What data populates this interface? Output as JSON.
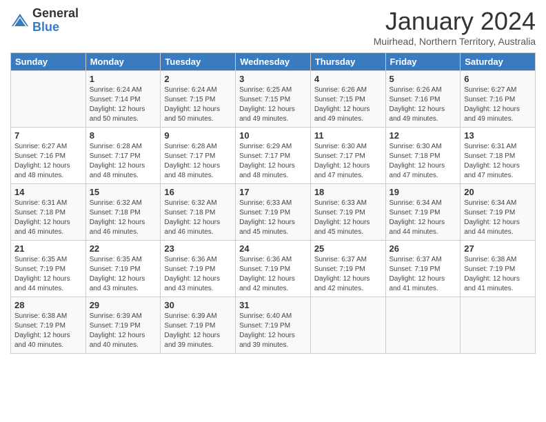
{
  "header": {
    "logo_general": "General",
    "logo_blue": "Blue",
    "month_title": "January 2024",
    "subtitle": "Muirhead, Northern Territory, Australia"
  },
  "days_of_week": [
    "Sunday",
    "Monday",
    "Tuesday",
    "Wednesday",
    "Thursday",
    "Friday",
    "Saturday"
  ],
  "weeks": [
    [
      {
        "day": "",
        "sunrise": "",
        "sunset": "",
        "daylight": ""
      },
      {
        "day": "1",
        "sunrise": "Sunrise: 6:24 AM",
        "sunset": "Sunset: 7:14 PM",
        "daylight": "Daylight: 12 hours and 50 minutes."
      },
      {
        "day": "2",
        "sunrise": "Sunrise: 6:24 AM",
        "sunset": "Sunset: 7:15 PM",
        "daylight": "Daylight: 12 hours and 50 minutes."
      },
      {
        "day": "3",
        "sunrise": "Sunrise: 6:25 AM",
        "sunset": "Sunset: 7:15 PM",
        "daylight": "Daylight: 12 hours and 49 minutes."
      },
      {
        "day": "4",
        "sunrise": "Sunrise: 6:26 AM",
        "sunset": "Sunset: 7:15 PM",
        "daylight": "Daylight: 12 hours and 49 minutes."
      },
      {
        "day": "5",
        "sunrise": "Sunrise: 6:26 AM",
        "sunset": "Sunset: 7:16 PM",
        "daylight": "Daylight: 12 hours and 49 minutes."
      },
      {
        "day": "6",
        "sunrise": "Sunrise: 6:27 AM",
        "sunset": "Sunset: 7:16 PM",
        "daylight": "Daylight: 12 hours and 49 minutes."
      }
    ],
    [
      {
        "day": "7",
        "sunrise": "Sunrise: 6:27 AM",
        "sunset": "Sunset: 7:16 PM",
        "daylight": "Daylight: 12 hours and 48 minutes."
      },
      {
        "day": "8",
        "sunrise": "Sunrise: 6:28 AM",
        "sunset": "Sunset: 7:17 PM",
        "daylight": "Daylight: 12 hours and 48 minutes."
      },
      {
        "day": "9",
        "sunrise": "Sunrise: 6:28 AM",
        "sunset": "Sunset: 7:17 PM",
        "daylight": "Daylight: 12 hours and 48 minutes."
      },
      {
        "day": "10",
        "sunrise": "Sunrise: 6:29 AM",
        "sunset": "Sunset: 7:17 PM",
        "daylight": "Daylight: 12 hours and 48 minutes."
      },
      {
        "day": "11",
        "sunrise": "Sunrise: 6:30 AM",
        "sunset": "Sunset: 7:17 PM",
        "daylight": "Daylight: 12 hours and 47 minutes."
      },
      {
        "day": "12",
        "sunrise": "Sunrise: 6:30 AM",
        "sunset": "Sunset: 7:18 PM",
        "daylight": "Daylight: 12 hours and 47 minutes."
      },
      {
        "day": "13",
        "sunrise": "Sunrise: 6:31 AM",
        "sunset": "Sunset: 7:18 PM",
        "daylight": "Daylight: 12 hours and 47 minutes."
      }
    ],
    [
      {
        "day": "14",
        "sunrise": "Sunrise: 6:31 AM",
        "sunset": "Sunset: 7:18 PM",
        "daylight": "Daylight: 12 hours and 46 minutes."
      },
      {
        "day": "15",
        "sunrise": "Sunrise: 6:32 AM",
        "sunset": "Sunset: 7:18 PM",
        "daylight": "Daylight: 12 hours and 46 minutes."
      },
      {
        "day": "16",
        "sunrise": "Sunrise: 6:32 AM",
        "sunset": "Sunset: 7:18 PM",
        "daylight": "Daylight: 12 hours and 46 minutes."
      },
      {
        "day": "17",
        "sunrise": "Sunrise: 6:33 AM",
        "sunset": "Sunset: 7:19 PM",
        "daylight": "Daylight: 12 hours and 45 minutes."
      },
      {
        "day": "18",
        "sunrise": "Sunrise: 6:33 AM",
        "sunset": "Sunset: 7:19 PM",
        "daylight": "Daylight: 12 hours and 45 minutes."
      },
      {
        "day": "19",
        "sunrise": "Sunrise: 6:34 AM",
        "sunset": "Sunset: 7:19 PM",
        "daylight": "Daylight: 12 hours and 44 minutes."
      },
      {
        "day": "20",
        "sunrise": "Sunrise: 6:34 AM",
        "sunset": "Sunset: 7:19 PM",
        "daylight": "Daylight: 12 hours and 44 minutes."
      }
    ],
    [
      {
        "day": "21",
        "sunrise": "Sunrise: 6:35 AM",
        "sunset": "Sunset: 7:19 PM",
        "daylight": "Daylight: 12 hours and 44 minutes."
      },
      {
        "day": "22",
        "sunrise": "Sunrise: 6:35 AM",
        "sunset": "Sunset: 7:19 PM",
        "daylight": "Daylight: 12 hours and 43 minutes."
      },
      {
        "day": "23",
        "sunrise": "Sunrise: 6:36 AM",
        "sunset": "Sunset: 7:19 PM",
        "daylight": "Daylight: 12 hours and 43 minutes."
      },
      {
        "day": "24",
        "sunrise": "Sunrise: 6:36 AM",
        "sunset": "Sunset: 7:19 PM",
        "daylight": "Daylight: 12 hours and 42 minutes."
      },
      {
        "day": "25",
        "sunrise": "Sunrise: 6:37 AM",
        "sunset": "Sunset: 7:19 PM",
        "daylight": "Daylight: 12 hours and 42 minutes."
      },
      {
        "day": "26",
        "sunrise": "Sunrise: 6:37 AM",
        "sunset": "Sunset: 7:19 PM",
        "daylight": "Daylight: 12 hours and 41 minutes."
      },
      {
        "day": "27",
        "sunrise": "Sunrise: 6:38 AM",
        "sunset": "Sunset: 7:19 PM",
        "daylight": "Daylight: 12 hours and 41 minutes."
      }
    ],
    [
      {
        "day": "28",
        "sunrise": "Sunrise: 6:38 AM",
        "sunset": "Sunset: 7:19 PM",
        "daylight": "Daylight: 12 hours and 40 minutes."
      },
      {
        "day": "29",
        "sunrise": "Sunrise: 6:39 AM",
        "sunset": "Sunset: 7:19 PM",
        "daylight": "Daylight: 12 hours and 40 minutes."
      },
      {
        "day": "30",
        "sunrise": "Sunrise: 6:39 AM",
        "sunset": "Sunset: 7:19 PM",
        "daylight": "Daylight: 12 hours and 39 minutes."
      },
      {
        "day": "31",
        "sunrise": "Sunrise: 6:40 AM",
        "sunset": "Sunset: 7:19 PM",
        "daylight": "Daylight: 12 hours and 39 minutes."
      },
      {
        "day": "",
        "sunrise": "",
        "sunset": "",
        "daylight": ""
      },
      {
        "day": "",
        "sunrise": "",
        "sunset": "",
        "daylight": ""
      },
      {
        "day": "",
        "sunrise": "",
        "sunset": "",
        "daylight": ""
      }
    ]
  ]
}
